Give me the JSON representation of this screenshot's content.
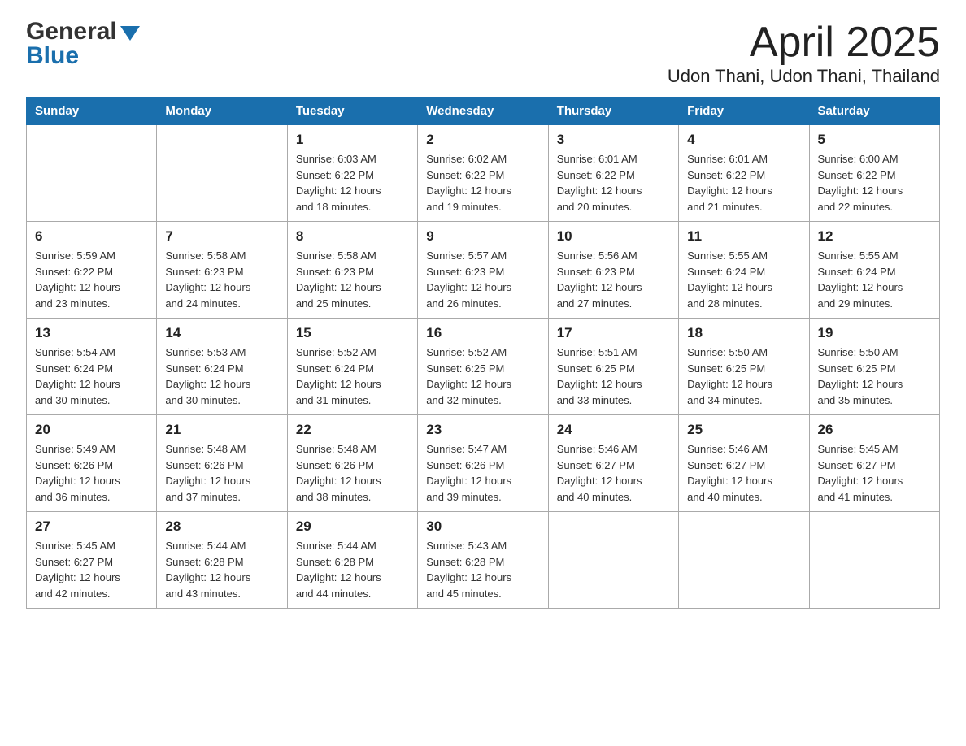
{
  "header": {
    "logo_general": "General",
    "logo_blue": "Blue",
    "title": "April 2025",
    "subtitle": "Udon Thani, Udon Thani, Thailand"
  },
  "calendar": {
    "days_of_week": [
      "Sunday",
      "Monday",
      "Tuesday",
      "Wednesday",
      "Thursday",
      "Friday",
      "Saturday"
    ],
    "weeks": [
      [
        {
          "day": "",
          "info": ""
        },
        {
          "day": "",
          "info": ""
        },
        {
          "day": "1",
          "info": "Sunrise: 6:03 AM\nSunset: 6:22 PM\nDaylight: 12 hours\nand 18 minutes."
        },
        {
          "day": "2",
          "info": "Sunrise: 6:02 AM\nSunset: 6:22 PM\nDaylight: 12 hours\nand 19 minutes."
        },
        {
          "day": "3",
          "info": "Sunrise: 6:01 AM\nSunset: 6:22 PM\nDaylight: 12 hours\nand 20 minutes."
        },
        {
          "day": "4",
          "info": "Sunrise: 6:01 AM\nSunset: 6:22 PM\nDaylight: 12 hours\nand 21 minutes."
        },
        {
          "day": "5",
          "info": "Sunrise: 6:00 AM\nSunset: 6:22 PM\nDaylight: 12 hours\nand 22 minutes."
        }
      ],
      [
        {
          "day": "6",
          "info": "Sunrise: 5:59 AM\nSunset: 6:22 PM\nDaylight: 12 hours\nand 23 minutes."
        },
        {
          "day": "7",
          "info": "Sunrise: 5:58 AM\nSunset: 6:23 PM\nDaylight: 12 hours\nand 24 minutes."
        },
        {
          "day": "8",
          "info": "Sunrise: 5:58 AM\nSunset: 6:23 PM\nDaylight: 12 hours\nand 25 minutes."
        },
        {
          "day": "9",
          "info": "Sunrise: 5:57 AM\nSunset: 6:23 PM\nDaylight: 12 hours\nand 26 minutes."
        },
        {
          "day": "10",
          "info": "Sunrise: 5:56 AM\nSunset: 6:23 PM\nDaylight: 12 hours\nand 27 minutes."
        },
        {
          "day": "11",
          "info": "Sunrise: 5:55 AM\nSunset: 6:24 PM\nDaylight: 12 hours\nand 28 minutes."
        },
        {
          "day": "12",
          "info": "Sunrise: 5:55 AM\nSunset: 6:24 PM\nDaylight: 12 hours\nand 29 minutes."
        }
      ],
      [
        {
          "day": "13",
          "info": "Sunrise: 5:54 AM\nSunset: 6:24 PM\nDaylight: 12 hours\nand 30 minutes."
        },
        {
          "day": "14",
          "info": "Sunrise: 5:53 AM\nSunset: 6:24 PM\nDaylight: 12 hours\nand 30 minutes."
        },
        {
          "day": "15",
          "info": "Sunrise: 5:52 AM\nSunset: 6:24 PM\nDaylight: 12 hours\nand 31 minutes."
        },
        {
          "day": "16",
          "info": "Sunrise: 5:52 AM\nSunset: 6:25 PM\nDaylight: 12 hours\nand 32 minutes."
        },
        {
          "day": "17",
          "info": "Sunrise: 5:51 AM\nSunset: 6:25 PM\nDaylight: 12 hours\nand 33 minutes."
        },
        {
          "day": "18",
          "info": "Sunrise: 5:50 AM\nSunset: 6:25 PM\nDaylight: 12 hours\nand 34 minutes."
        },
        {
          "day": "19",
          "info": "Sunrise: 5:50 AM\nSunset: 6:25 PM\nDaylight: 12 hours\nand 35 minutes."
        }
      ],
      [
        {
          "day": "20",
          "info": "Sunrise: 5:49 AM\nSunset: 6:26 PM\nDaylight: 12 hours\nand 36 minutes."
        },
        {
          "day": "21",
          "info": "Sunrise: 5:48 AM\nSunset: 6:26 PM\nDaylight: 12 hours\nand 37 minutes."
        },
        {
          "day": "22",
          "info": "Sunrise: 5:48 AM\nSunset: 6:26 PM\nDaylight: 12 hours\nand 38 minutes."
        },
        {
          "day": "23",
          "info": "Sunrise: 5:47 AM\nSunset: 6:26 PM\nDaylight: 12 hours\nand 39 minutes."
        },
        {
          "day": "24",
          "info": "Sunrise: 5:46 AM\nSunset: 6:27 PM\nDaylight: 12 hours\nand 40 minutes."
        },
        {
          "day": "25",
          "info": "Sunrise: 5:46 AM\nSunset: 6:27 PM\nDaylight: 12 hours\nand 40 minutes."
        },
        {
          "day": "26",
          "info": "Sunrise: 5:45 AM\nSunset: 6:27 PM\nDaylight: 12 hours\nand 41 minutes."
        }
      ],
      [
        {
          "day": "27",
          "info": "Sunrise: 5:45 AM\nSunset: 6:27 PM\nDaylight: 12 hours\nand 42 minutes."
        },
        {
          "day": "28",
          "info": "Sunrise: 5:44 AM\nSunset: 6:28 PM\nDaylight: 12 hours\nand 43 minutes."
        },
        {
          "day": "29",
          "info": "Sunrise: 5:44 AM\nSunset: 6:28 PM\nDaylight: 12 hours\nand 44 minutes."
        },
        {
          "day": "30",
          "info": "Sunrise: 5:43 AM\nSunset: 6:28 PM\nDaylight: 12 hours\nand 45 minutes."
        },
        {
          "day": "",
          "info": ""
        },
        {
          "day": "",
          "info": ""
        },
        {
          "day": "",
          "info": ""
        }
      ]
    ]
  }
}
